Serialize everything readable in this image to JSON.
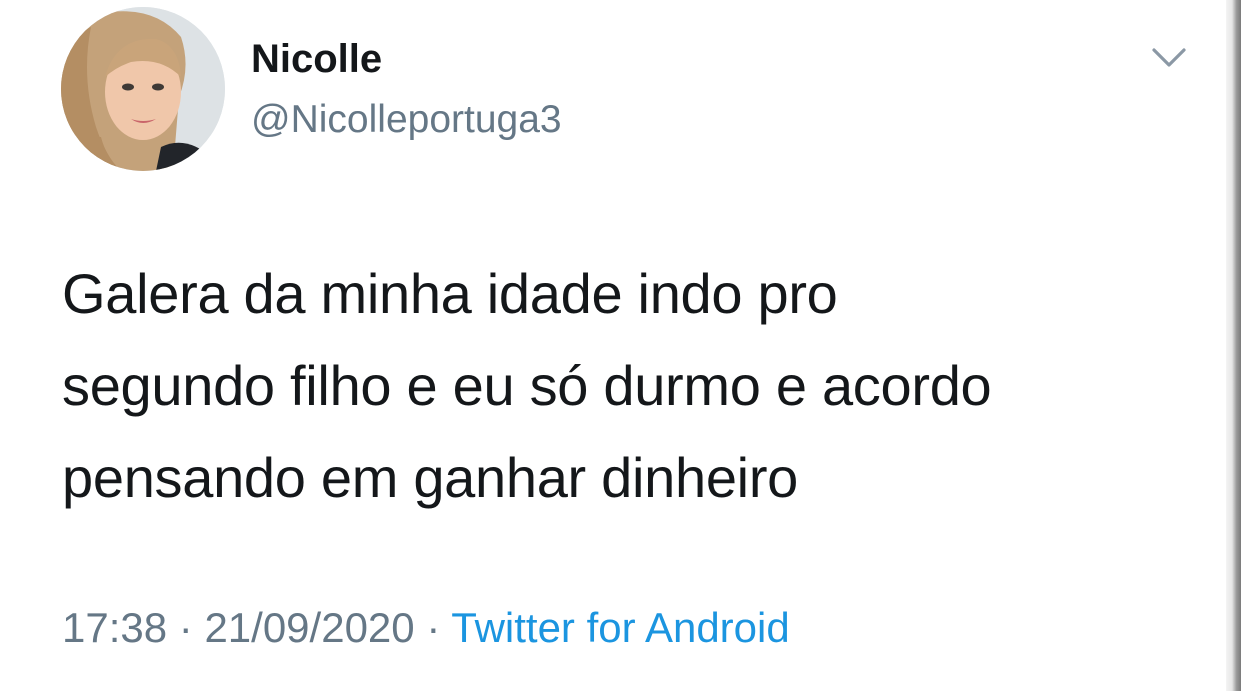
{
  "tweet": {
    "author": {
      "name": "Nicolle",
      "handle": "@Nicolleportuga3"
    },
    "text_lines": [
      "Galera da minha idade indo pro",
      "segundo filho e eu só durmo e acordo",
      "pensando em ganhar dinheiro"
    ],
    "meta": {
      "time": "17:38",
      "separator": " · ",
      "date": "21/09/2020",
      "source": "Twitter for Android"
    },
    "colors": {
      "text": "#14171a",
      "secondary": "#657786",
      "link": "#1b95e0"
    },
    "icons": {
      "menu": "chevron-down-icon"
    }
  }
}
